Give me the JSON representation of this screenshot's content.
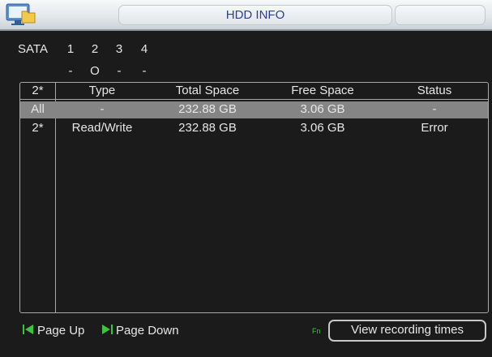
{
  "window": {
    "title": "HDD INFO",
    "icon": "hdd-info-icon"
  },
  "sata": {
    "label": "SATA",
    "ports": [
      "1",
      "2",
      "3",
      "4"
    ],
    "status": [
      "-",
      "O",
      "-",
      "-"
    ]
  },
  "table": {
    "headers": [
      "2*",
      "Type",
      "Total Space",
      "Free Space",
      "Status"
    ],
    "rows": [
      {
        "disk": "All",
        "type": "-",
        "total_space": "232.88 GB",
        "free_space": "3.06 GB",
        "status": "-",
        "selected": true
      },
      {
        "disk": "2*",
        "type": "Read/Write",
        "total_space": "232.88 GB",
        "free_space": "3.06 GB",
        "status": "Error",
        "selected": false
      }
    ]
  },
  "footer": {
    "page_up": "Page Up",
    "page_up_icon": "page-up-icon",
    "page_down": "Page Down",
    "page_down_icon": "page-down-icon",
    "fn_hint": "Fn",
    "view_recording_times": "View recording times"
  },
  "colors": {
    "background": "#1b1b1b",
    "title_text": "#2a3f95",
    "text": "#e6e6e6",
    "selected_row": "#858585",
    "border": "#a8a8a8",
    "nav_icon": "#3cc43c"
  }
}
